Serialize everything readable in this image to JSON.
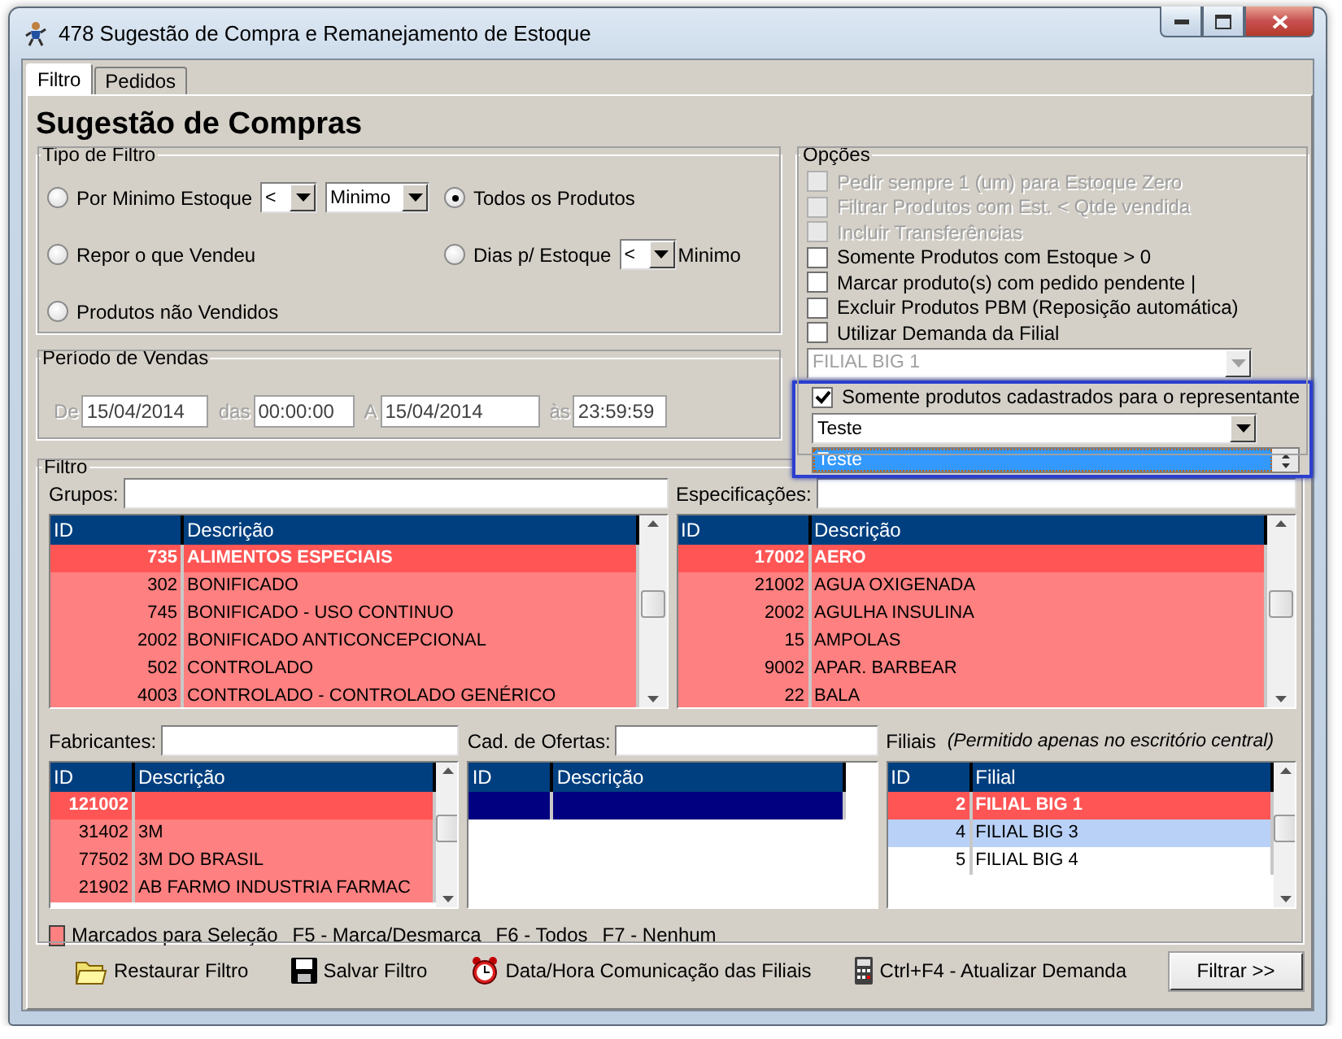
{
  "window": {
    "title": "478 Sugestão de Compra e Remanejamento de Estoque"
  },
  "tabs": [
    {
      "label": "Filtro",
      "selected": true
    },
    {
      "label": "Pedidos",
      "selected": false
    }
  ],
  "heading": "Sugestão de Compras",
  "filter_type": {
    "title": "Tipo de Filtro",
    "options": [
      {
        "label": "Por Minimo Estoque",
        "selected": false,
        "dropdowns": [
          "<",
          "Minimo"
        ]
      },
      {
        "label": "Todos os Produtos",
        "selected": true
      },
      {
        "label": "Repor o que Vendeu",
        "selected": false
      },
      {
        "label": "Dias p/ Estoque",
        "selected": false,
        "dropdowns": [
          "<"
        ],
        "suffix": "Minimo"
      },
      {
        "label": "Produtos não Vendidos",
        "selected": false
      }
    ]
  },
  "sales_period": {
    "title": "Período de Vendas",
    "disabled": true,
    "fields": [
      {
        "label": "De",
        "value": "15/04/2014"
      },
      {
        "label": "das",
        "value": "00:00:00"
      },
      {
        "label": "A",
        "value": "15/04/2014"
      },
      {
        "label": "às",
        "value": "23:59:59"
      }
    ]
  },
  "options": {
    "title": "Opções",
    "checkboxes": [
      {
        "label": "Pedir sempre 1 (um) para Estoque Zero",
        "checked": false,
        "disabled": true
      },
      {
        "label": "Filtrar Produtos com Est. < Qtde vendida",
        "checked": false,
        "disabled": true
      },
      {
        "label": "Incluir Transferências",
        "checked": false,
        "disabled": true
      },
      {
        "label": "Somente Produtos com Estoque > 0",
        "checked": false,
        "disabled": false
      },
      {
        "label": "Marcar produto(s) com pedido pendente |",
        "checked": false,
        "disabled": false
      },
      {
        "label": "Excluir Produtos PBM (Reposição automática)",
        "checked": false,
        "disabled": false
      },
      {
        "label": "Utilizar Demanda da Filial",
        "checked": false,
        "disabled": false
      }
    ],
    "branch_select": {
      "value": "FILIAL BIG 1",
      "disabled": true
    },
    "representative": {
      "label": "Somente produtos cadastrados para o representante",
      "checked": true,
      "select_value": "Teste",
      "list_items": [
        {
          "label": "Teste",
          "selected": true
        }
      ]
    }
  },
  "filter": {
    "title": "Filtro",
    "groups": {
      "label": "Grupos:",
      "columns": [
        "ID",
        "Descrição"
      ],
      "rows": [
        {
          "id": "735",
          "description": "ALIMENTOS ESPECIAIS",
          "selected": true,
          "marked": true
        },
        {
          "id": "302",
          "description": "BONIFICADO",
          "selected": false,
          "marked": true
        },
        {
          "id": "745",
          "description": "BONIFICADO - USO CONTINUO",
          "selected": false,
          "marked": true
        },
        {
          "id": "2002",
          "description": "BONIFICADO ANTICONCEPCIONAL",
          "selected": false,
          "marked": true
        },
        {
          "id": "502",
          "description": "CONTROLADO",
          "selected": false,
          "marked": true
        },
        {
          "id": "4003",
          "description": "CONTROLADO - CONTROLADO GENÉRICO",
          "selected": false,
          "marked": true
        }
      ]
    },
    "specifications": {
      "label": "Especificações:",
      "columns": [
        "ID",
        "Descrição"
      ],
      "rows": [
        {
          "id": "17002",
          "description": "AERO",
          "selected": true,
          "marked": true
        },
        {
          "id": "21002",
          "description": "AGUA OXIGENADA",
          "selected": false,
          "marked": true
        },
        {
          "id": "2002",
          "description": "AGULHA INSULINA",
          "selected": false,
          "marked": true
        },
        {
          "id": "15",
          "description": "AMPOLAS",
          "selected": false,
          "marked": true
        },
        {
          "id": "9002",
          "description": "APAR. BARBEAR",
          "selected": false,
          "marked": true
        },
        {
          "id": "22",
          "description": "BALA",
          "selected": false,
          "marked": true
        }
      ]
    },
    "manufacturers": {
      "label": "Fabricantes:",
      "columns": [
        "ID",
        "Descrição"
      ],
      "rows": [
        {
          "id": "121002",
          "selected": true,
          "marked": true
        },
        {
          "id": "31402",
          "description": "3M",
          "selected": false,
          "marked": true
        },
        {
          "id": "77502",
          "description": "3M DO BRASIL",
          "selected": false,
          "marked": true
        },
        {
          "id": "21902",
          "description": "AB FARMO INDUSTRIA FARMAC",
          "selected": false,
          "marked": true
        }
      ]
    },
    "offers": {
      "label": "Cad. de Ofertas:",
      "columns": [
        "ID",
        "Descrição"
      ],
      "rows": [
        {
          "selected": true,
          "marked": false
        }
      ]
    },
    "branches": {
      "label": "Filiais",
      "note": "(Permitido apenas no escritório central)",
      "columns": [
        "ID",
        "Filial"
      ],
      "rows": [
        {
          "id": "2",
          "description": "FILIAL BIG 1",
          "selected": true,
          "marked": true,
          "highlighted": false
        },
        {
          "id": "4",
          "description": "FILIAL BIG 3",
          "selected": false,
          "marked": false,
          "highlighted": true
        },
        {
          "id": "5",
          "description": "FILIAL BIG 4",
          "selected": false,
          "marked": false,
          "highlighted": false
        }
      ]
    }
  },
  "legend": {
    "marked_label": "Marcados para Seleção",
    "shortcuts": [
      "F5 - Marca/Desmarca",
      "F6 - Todos",
      "F7 - Nenhum"
    ]
  },
  "toolbar": [
    {
      "label": "Restaurar Filtro",
      "kind": "folder"
    },
    {
      "label": "Salvar Filtro",
      "kind": "save"
    },
    {
      "label": "Data/Hora Comunicação das Filiais",
      "kind": "clock"
    },
    {
      "label": "Ctrl+F4 - Atualizar Demanda",
      "kind": "calculator"
    }
  ],
  "submit": "Filtrar >>"
}
